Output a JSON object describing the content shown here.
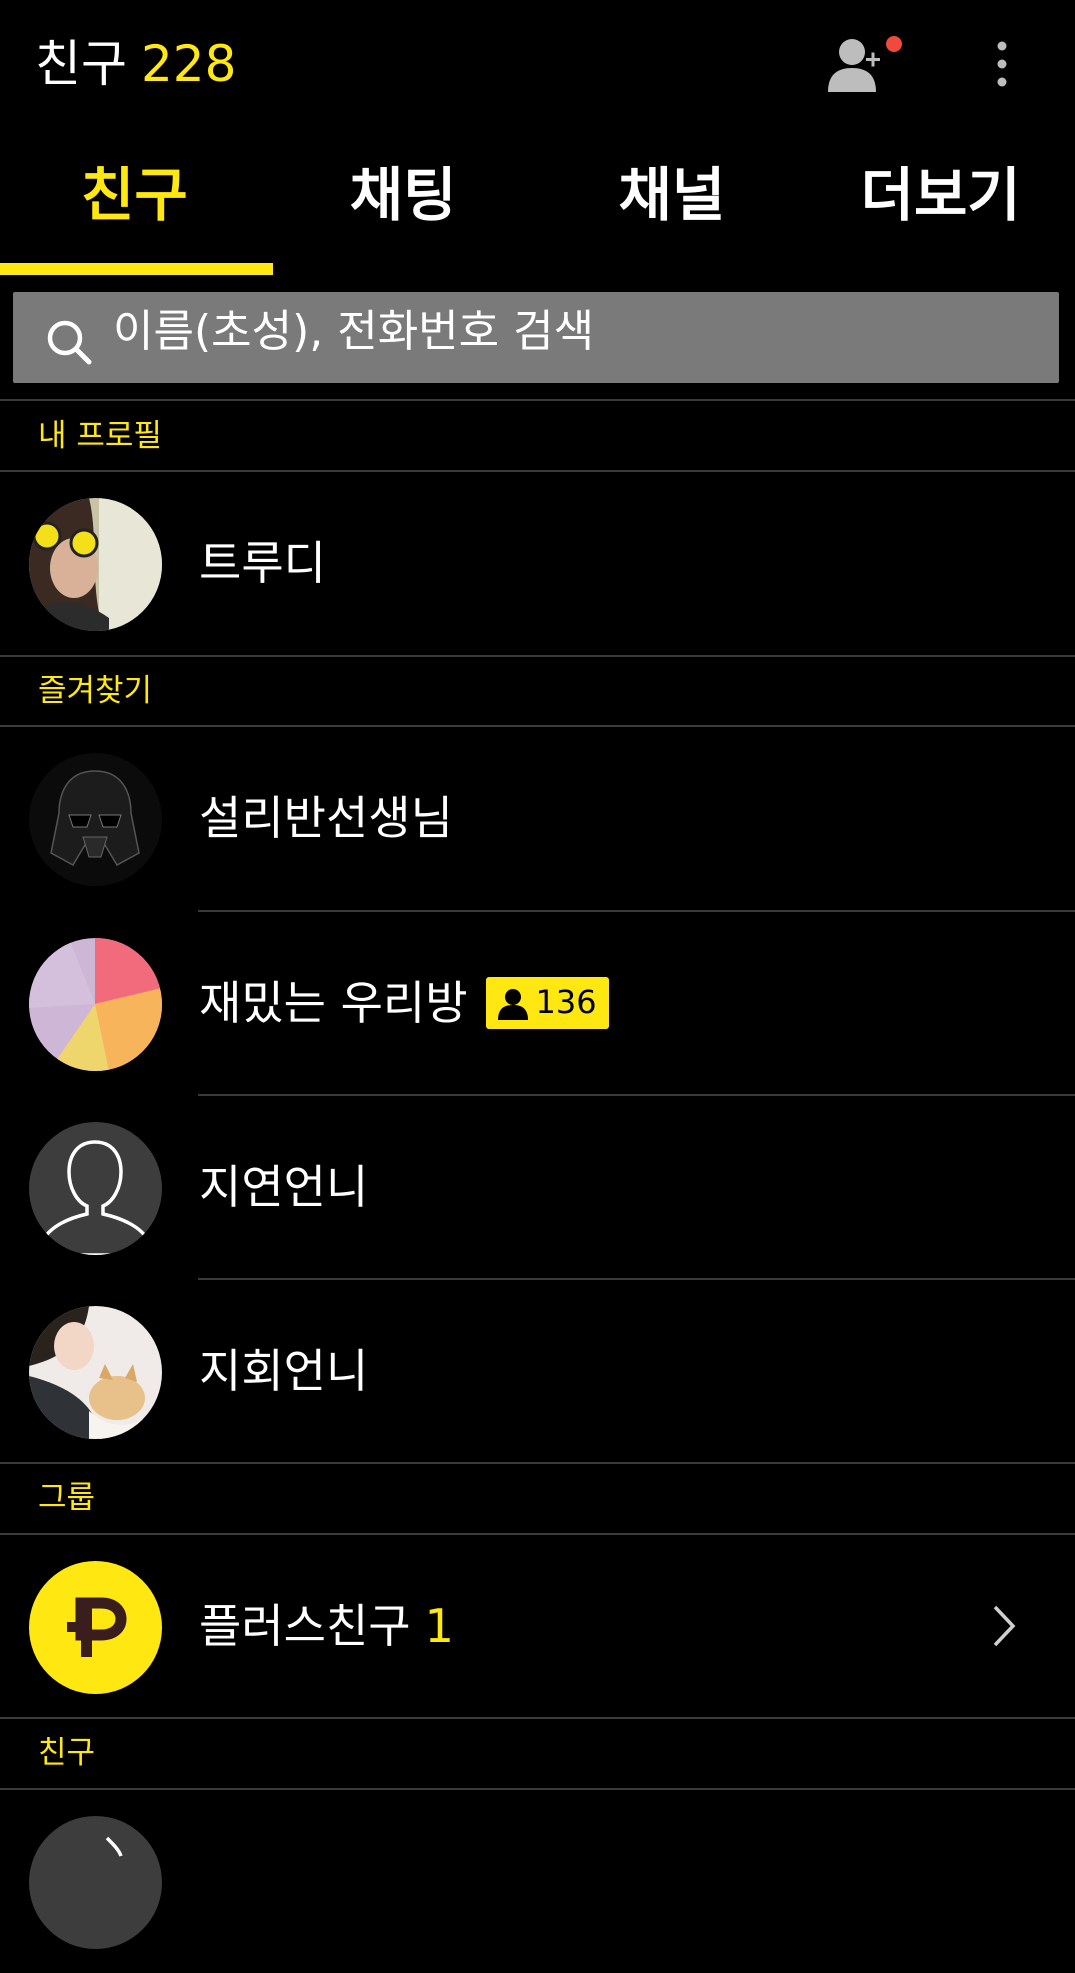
{
  "header": {
    "title": "친구",
    "count": "228"
  },
  "tabs": [
    {
      "label": "친구",
      "active": true
    },
    {
      "label": "채팅",
      "active": false
    },
    {
      "label": "채널",
      "active": false
    },
    {
      "label": "더보기",
      "active": false
    }
  ],
  "search": {
    "placeholder": "이름(초성), 전화번호 검색"
  },
  "sections": {
    "my_profile": "내 프로필",
    "favorites": "즐겨찾기",
    "groups": "그룹",
    "friends": "친구"
  },
  "my_profile": {
    "name": "트루디"
  },
  "favorites": [
    {
      "name": "설리반선생님"
    },
    {
      "name": "재밌는 우리방",
      "member_count": "136"
    },
    {
      "name": "지연언니"
    },
    {
      "name": "지회언니"
    }
  ],
  "groups": [
    {
      "name": "플러스친구",
      "count": "1"
    }
  ],
  "colors": {
    "accent": "#ffe812",
    "background": "#000000",
    "search_bg": "#7a7a7a",
    "divider": "#3a3a3a",
    "notify_dot": "#f04a3e"
  },
  "icons": [
    "add-friend-icon",
    "more-vert-icon",
    "search-icon",
    "person-icon",
    "chevron-right-icon",
    "plus-friend-logo"
  ]
}
